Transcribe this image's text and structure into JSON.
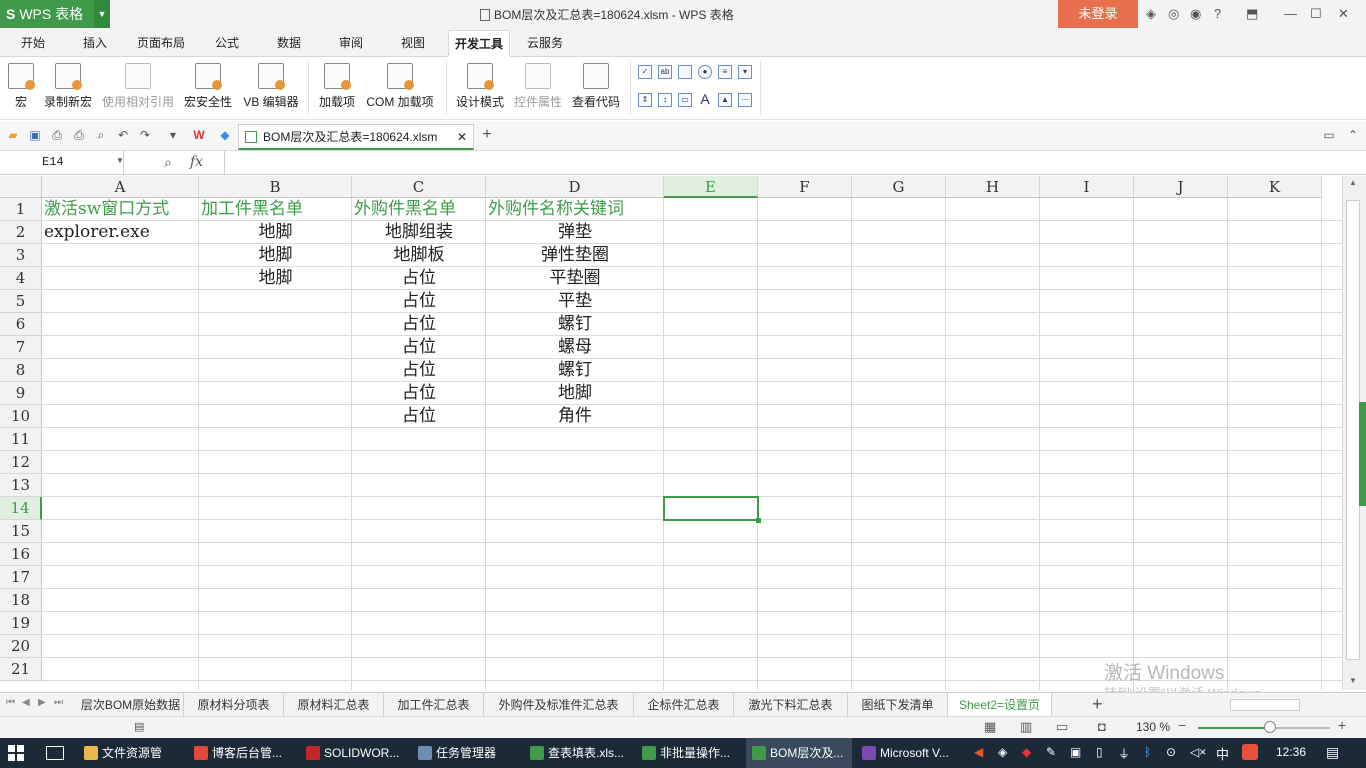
{
  "app": {
    "name": "WPS 表格",
    "window_title": "BOM层次及汇总表=180624.xlsm - WPS 表格",
    "login_label": "未登录"
  },
  "menu": [
    "开始",
    "插入",
    "页面布局",
    "公式",
    "数据",
    "审阅",
    "视图",
    "开发工具",
    "云服务"
  ],
  "menu_active": "开发工具",
  "ribbon": [
    {
      "label": "宏",
      "enabled": true
    },
    {
      "label": "录制新宏",
      "enabled": true
    },
    {
      "label": "使用相对引用",
      "enabled": false
    },
    {
      "label": "宏安全性",
      "enabled": true
    },
    {
      "label": "VB 编辑器",
      "enabled": true
    },
    {
      "label": "加载项",
      "enabled": true
    },
    {
      "label": "COM 加载项",
      "enabled": true
    },
    {
      "label": "设计模式",
      "enabled": true
    },
    {
      "label": "控件属性",
      "enabled": false
    },
    {
      "label": "查看代码",
      "enabled": true
    }
  ],
  "doc_tab": "BOM层次及汇总表=180624.xlsm",
  "name_box": "E14",
  "fx_label": "fx",
  "columns": [
    "A",
    "B",
    "C",
    "D",
    "E",
    "F",
    "G",
    "H",
    "I",
    "J",
    "K"
  ],
  "selected_column": "E",
  "rows": [
    "1",
    "2",
    "3",
    "4",
    "5",
    "6",
    "7",
    "8",
    "9",
    "10",
    "11",
    "12",
    "13",
    "14",
    "15",
    "16",
    "17",
    "18",
    "19",
    "20",
    "21"
  ],
  "selected_row": "14",
  "header_row": [
    "激活sw窗口方式",
    "加工件黑名单",
    "外购件黑名单",
    "外购件名称关键词"
  ],
  "data_rows": [
    [
      "explorer.exe",
      "地脚",
      "地脚组装",
      "弹垫"
    ],
    [
      "",
      "地脚",
      "地脚板",
      "弹性垫圈"
    ],
    [
      "",
      "地脚",
      "占位",
      "平垫圈"
    ],
    [
      "",
      "",
      "占位",
      "平垫"
    ],
    [
      "",
      "",
      "占位",
      "螺钉"
    ],
    [
      "",
      "",
      "占位",
      "螺母"
    ],
    [
      "",
      "",
      "占位",
      "螺钉"
    ],
    [
      "",
      "",
      "占位",
      "地脚"
    ],
    [
      "",
      "",
      "占位",
      "角件"
    ]
  ],
  "sheets": [
    "层次BOM原始数据",
    "原材料分项表",
    "原材料汇总表",
    "加工件汇总表",
    "外购件及标准件汇总表",
    "企标件汇总表",
    "激光下料汇总表",
    "图纸下发清单",
    "Sheet2=设置页"
  ],
  "active_sheet": "Sheet2=设置页",
  "zoom": "130 %",
  "watermark": {
    "line1": "激活 Windows",
    "line2": "转到\"设置\"以激活 Windows。"
  },
  "taskbar": {
    "items": [
      {
        "label": "文件资源管",
        "color": "#e8b84a"
      },
      {
        "label": "博客后台管...",
        "color": "#e04a3a"
      },
      {
        "label": "SOLIDWOR...",
        "color": "#c0282a"
      },
      {
        "label": "任务管理器",
        "color": "#6a8fb0"
      },
      {
        "label": "查表填表.xls...",
        "color": "#3f9b4a"
      },
      {
        "label": "非批量操作...",
        "color": "#3f9b4a"
      },
      {
        "label": "BOM层次及...",
        "color": "#3f9b4a"
      },
      {
        "label": "Microsoft V...",
        "color": "#7a4ab0"
      }
    ],
    "active": "BOM层次及...",
    "ime": "中",
    "clock": "12:36"
  }
}
